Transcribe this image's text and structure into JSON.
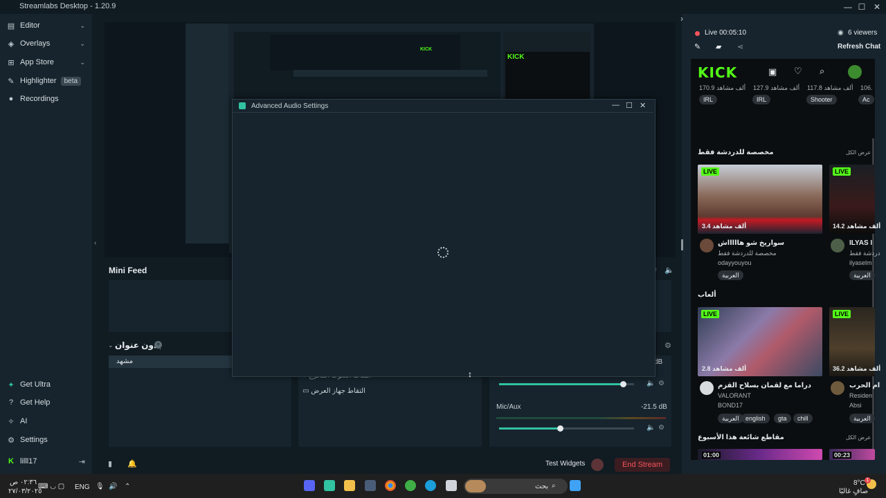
{
  "app": {
    "title": "Streamlabs Desktop - 1.20.9"
  },
  "sidebar": {
    "items": [
      {
        "label": "Editor"
      },
      {
        "label": "Overlays"
      },
      {
        "label": "App Store"
      },
      {
        "label": "Highlighter",
        "badge": "beta"
      },
      {
        "label": "Recordings"
      }
    ],
    "bottom": [
      {
        "label": "Get Ultra"
      },
      {
        "label": "Get Help"
      },
      {
        "label": "AI"
      },
      {
        "label": "Settings"
      }
    ],
    "user": "lilll17"
  },
  "modal": {
    "title": "Advanced Audio Settings"
  },
  "minifeed": {
    "title": "Mini Feed"
  },
  "scenes": {
    "header": "بدون عنوان",
    "items": [
      "مشهد"
    ]
  },
  "sources": {
    "items": [
      "التقاط الصوت المخرج",
      "التقاط جهاز العرض"
    ]
  },
  "mixer": {
    "channels": [
      {
        "name": "",
        "db": "dB",
        "level": 0.92
      },
      {
        "name": "Mic/Aux",
        "db": "-21.5 dB",
        "level": 0.45
      }
    ]
  },
  "bottombar": {
    "test_widgets": "Test Widgets",
    "end_stream": "End Stream"
  },
  "chat": {
    "live_status": "Live 00:05:10",
    "viewers": "6 viewers",
    "refresh": "Refresh Chat",
    "kick": {
      "logo": "KICK",
      "top_views": [
        "170.9 ألف مشاهد",
        "127.9 ألف مشاهد",
        "117.8 ألف مشاهد",
        "106."
      ],
      "top_tags": [
        "IRL",
        "IRL",
        "Shooter",
        "Ac"
      ],
      "section1": {
        "title": "مخصصة للدردشة فقط",
        "see_all": "عرض الكل"
      },
      "cards1": [
        {
          "live": "LIVE",
          "viewers": "3.4 ألف مشاهد",
          "title": "سواريخ شو هاااااش",
          "category": "مخصصة للدردشة فقط",
          "user": "odayyouyou",
          "tags": [
            "العربية"
          ]
        },
        {
          "live": "LIVE",
          "viewers": "14.2 ألف مشاهد",
          "title": "ILYAS I",
          "category": "دردشة فقط",
          "user": "ilyaselm",
          "tags": [
            "العربية"
          ]
        }
      ],
      "section2": {
        "title": "ألعاب"
      },
      "cards2": [
        {
          "live": "LIVE",
          "viewers": "2.8 ألف مشاهد",
          "title": "دراما مع لقمان بسلاح القزم",
          "category": "VALORANT",
          "user": "BOND17",
          "tags": [
            "العربية",
            "english",
            "gta",
            "chill"
          ]
        },
        {
          "live": "LIVE",
          "viewers": "36.2 ألف مشاهد",
          "title": "ام الحرب",
          "category": "Residen",
          "user": "Absi",
          "tags": [
            "العربية"
          ]
        }
      ],
      "section3": {
        "title": "مقاطع شائعة هذا الأسبوع",
        "see_all": "عرض الكل"
      },
      "clips": [
        "01:00",
        "00:23"
      ]
    }
  },
  "taskbar": {
    "time": "٠٢:٣٦ ص",
    "date": "٢٧/٠٣/٢٠٢٥",
    "lang": "ENG",
    "search": "بحث",
    "weather_temp": "8°C",
    "weather_desc": "صافٍ غالبًا",
    "notif_count": "1"
  }
}
